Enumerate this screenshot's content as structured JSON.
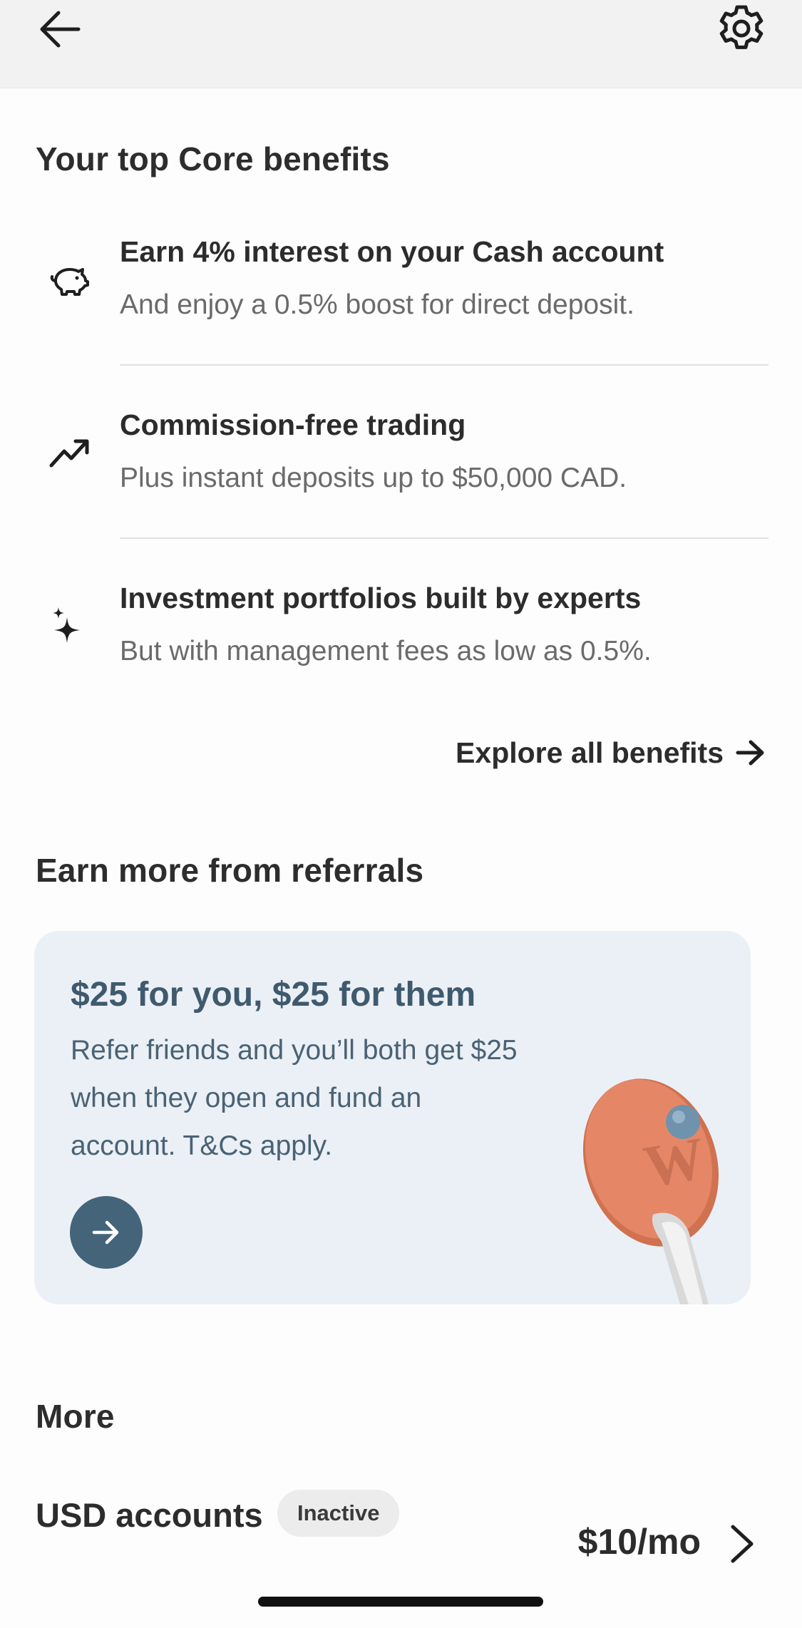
{
  "header": {
    "back_icon": "arrow-left-icon",
    "settings_icon": "gear-icon"
  },
  "benefits_section": {
    "title": "Your top Core benefits",
    "items": [
      {
        "icon": "piggy-bank-icon",
        "title": "Earn 4% interest on your Cash account",
        "description": "And enjoy a 0.5% boost for direct deposit."
      },
      {
        "icon": "trending-up-icon",
        "title": "Commission-free trading",
        "description": "Plus instant deposits up to $50,000 CAD."
      },
      {
        "icon": "sparkles-icon",
        "title": "Investment portfolios built by experts",
        "description": "But with management fees as low as 0.5%."
      }
    ],
    "explore_label": "Explore all benefits"
  },
  "referrals_section": {
    "title": "Earn more from referrals",
    "card": {
      "title": "$25 for you, $25 for them",
      "description": "Refer friends and you’ll both get $25 when they open and fund an account. T&Cs apply.",
      "button_icon": "arrow-right-icon",
      "image": "ping-pong-paddle-illustration"
    }
  },
  "more_section": {
    "title": "More",
    "rows": [
      {
        "title": "USD accounts",
        "badge": "Inactive",
        "price": "$10/mo",
        "icon": "chevron-right-icon"
      }
    ]
  },
  "colors": {
    "topbar_bg": "#f2f2f2",
    "card_bg": "#ebf0f6",
    "card_accent": "#44647a",
    "card_title": "#3f5a6e",
    "paddle": "#e07c5c"
  }
}
